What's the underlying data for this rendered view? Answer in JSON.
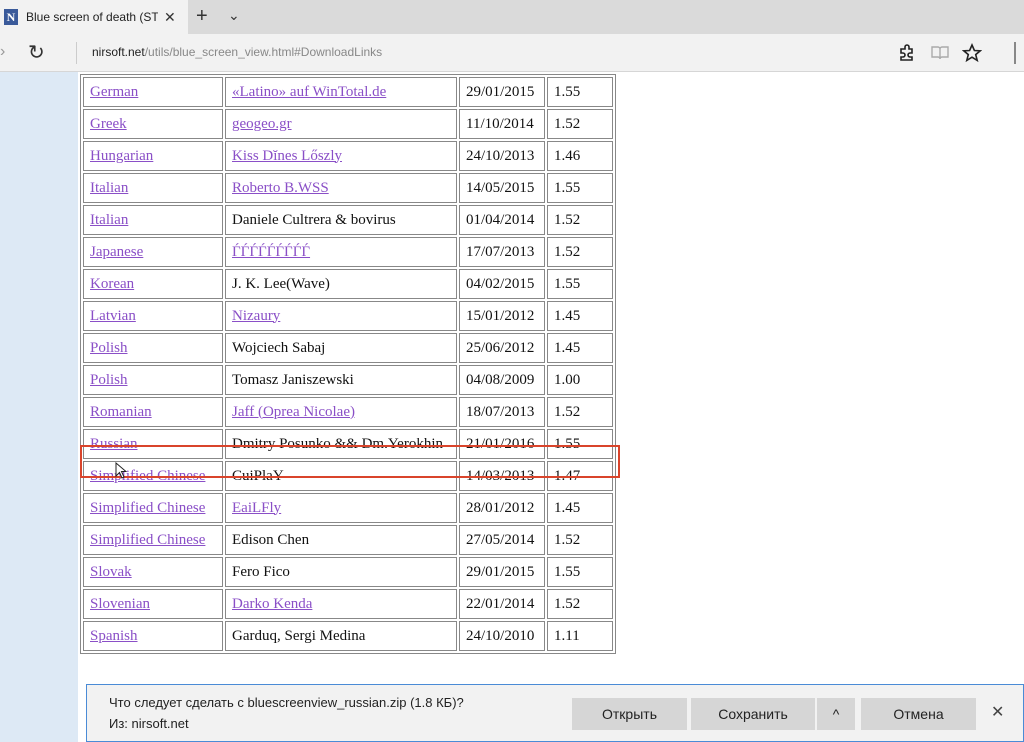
{
  "tab": {
    "favicon": "N",
    "title": "Blue screen of death (ST",
    "close": "✕",
    "new_tab": "+",
    "list": "⌄"
  },
  "address": {
    "back": "›",
    "refresh": "↻",
    "url_domain": "nirsoft.net",
    "url_path": "/utils/blue_screen_view.html#DownloadLinks"
  },
  "toolbar_icons": {
    "extensions": "puzzle-icon",
    "reading": "book-icon",
    "favorite": "star-icon"
  },
  "table": {
    "rows": [
      {
        "language": "German",
        "translator": "«Latino» auf WinTotal.de",
        "translator_link": true,
        "date": "29/01/2015",
        "version": "1.55"
      },
      {
        "language": "Greek",
        "translator": "geogeo.gr",
        "translator_link": true,
        "date": "11/10/2014",
        "version": "1.52"
      },
      {
        "language": "Hungarian",
        "translator": "Kiss Dĭnes Lőszly",
        "translator_link": true,
        "date": "24/10/2013",
        "version": "1.46"
      },
      {
        "language": "Italian",
        "translator": "Roberto B.WSS",
        "translator_link": true,
        "date": "14/05/2015",
        "version": "1.55"
      },
      {
        "language": "Italian",
        "translator": "Daniele Cultrera & bovirus",
        "translator_link": false,
        "date": "01/04/2014",
        "version": "1.52"
      },
      {
        "language": "Japanese",
        "translator": "ЃЃЃЃЃЃЃЃЃ",
        "translator_link": true,
        "date": "17/07/2013",
        "version": "1.52"
      },
      {
        "language": "Korean",
        "translator": "J. K. Lee(Wave)",
        "translator_link": false,
        "date": "04/02/2015",
        "version": "1.55"
      },
      {
        "language": "Latvian",
        "translator": "Nizaury",
        "translator_link": true,
        "date": "15/01/2012",
        "version": "1.45"
      },
      {
        "language": "Polish",
        "translator": "Wojciech Sabaj",
        "translator_link": false,
        "date": "25/06/2012",
        "version": "1.45"
      },
      {
        "language": "Polish",
        "translator": "Tomasz Janiszewski",
        "translator_link": false,
        "date": "04/08/2009",
        "version": "1.00"
      },
      {
        "language": "Romanian",
        "translator": "Jaff (Oprea Nicolae)",
        "translator_link": true,
        "date": "18/07/2013",
        "version": "1.52"
      },
      {
        "language": "Russian",
        "translator": "Dmitry Posunko && Dm.Yerokhin",
        "translator_link": false,
        "date": "21/01/2016",
        "version": "1.55"
      },
      {
        "language": "Simplified Chinese",
        "translator": "CuiPlaY",
        "translator_link": false,
        "date": "14/03/2013",
        "version": "1.47"
      },
      {
        "language": "Simplified Chinese",
        "translator": "EaiLFly",
        "translator_link": true,
        "date": "28/01/2012",
        "version": "1.45"
      },
      {
        "language": "Simplified Chinese",
        "translator": "Edison Chen",
        "translator_link": false,
        "date": "27/05/2014",
        "version": "1.52"
      },
      {
        "language": "Slovak",
        "translator": "Fero Fico",
        "translator_link": false,
        "date": "29/01/2015",
        "version": "1.55"
      },
      {
        "language": "Slovenian",
        "translator": "Darko Kenda",
        "translator_link": true,
        "date": "22/01/2014",
        "version": "1.52"
      },
      {
        "language": "Spanish",
        "translator": "Garduq, Sergi Medina",
        "translator_link": false,
        "date": "24/10/2010",
        "version": "1.11"
      }
    ]
  },
  "highlight_color": "#d9442b",
  "link_color": "#8a4fc7",
  "download": {
    "question": "Что следует сделать с bluescreenview_russian.zip (1.8 КБ)?",
    "from": "Из: nirsoft.net",
    "open": "Открыть",
    "save": "Сохранить",
    "save_more": "^",
    "cancel": "Отмена",
    "close": "✕"
  }
}
